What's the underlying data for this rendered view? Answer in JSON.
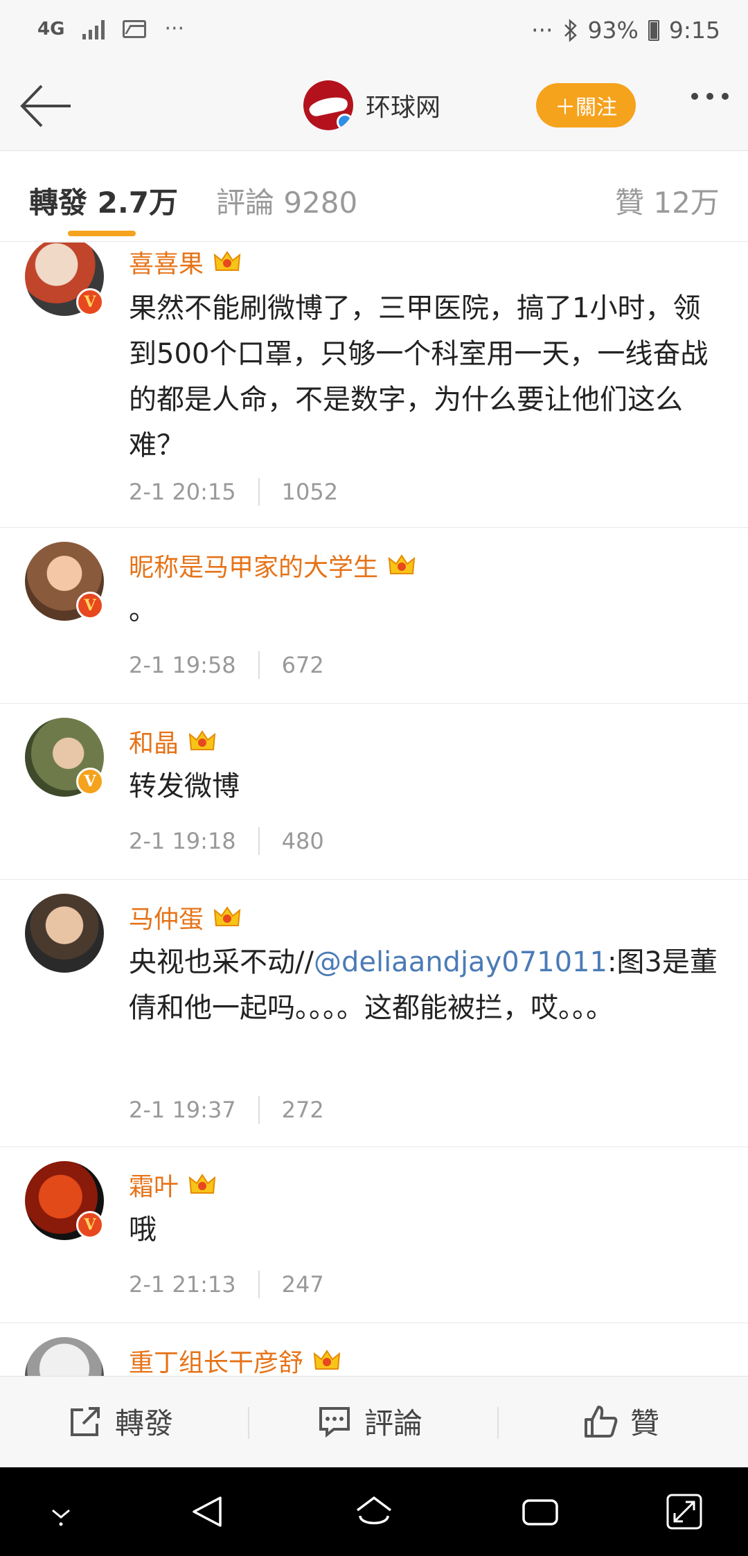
{
  "status_bar": {
    "network": "4G",
    "more_left": "···",
    "more_right": "···",
    "bluetooth": "bluetooth-icon",
    "battery": "93%",
    "time": "9:15"
  },
  "header": {
    "brand_name": "环球网",
    "follow_label": "＋關注"
  },
  "tabs": {
    "reposts": "轉發 2.7万",
    "comments": "評論 9280",
    "likes": "贊 12万"
  },
  "comments": [
    {
      "username": "喜喜果",
      "text": "果然不能刷微博了，三甲医院，搞了1小时，领到500个口罩，只够一个科室用一天，一线奋战的都是人命，不是数字，为什么要让他们这么难？",
      "time": "2-1 20:15",
      "likes": "1052"
    },
    {
      "username": "昵称是马甲家的大学生",
      "text": "。",
      "time": "2-1 19:58",
      "likes": "672"
    },
    {
      "username": "和晶",
      "text": "转发微博",
      "time": "2-1 19:18",
      "likes": "480"
    },
    {
      "username": "马仲蛋",
      "text_prefix": "央视也采不动//",
      "mention": "@deliaandjay071011",
      "text_suffix": ":图3是董倩和他一起吗。。。。这都能被拦，哎。。。",
      "time": "2-1 19:37",
      "likes": "272"
    },
    {
      "username": "霜叶",
      "text": "哦",
      "time": "2-1 21:13",
      "likes": "247"
    },
    {
      "username": "重丁组长干彦舒"
    }
  ],
  "action_bar": {
    "repost": "轉發",
    "comment": "評論",
    "like": "贊"
  },
  "colors": {
    "accent": "#f5a21c",
    "username": "#e67318",
    "mention": "#4b7bb6",
    "badge_red": "#e8481f"
  }
}
